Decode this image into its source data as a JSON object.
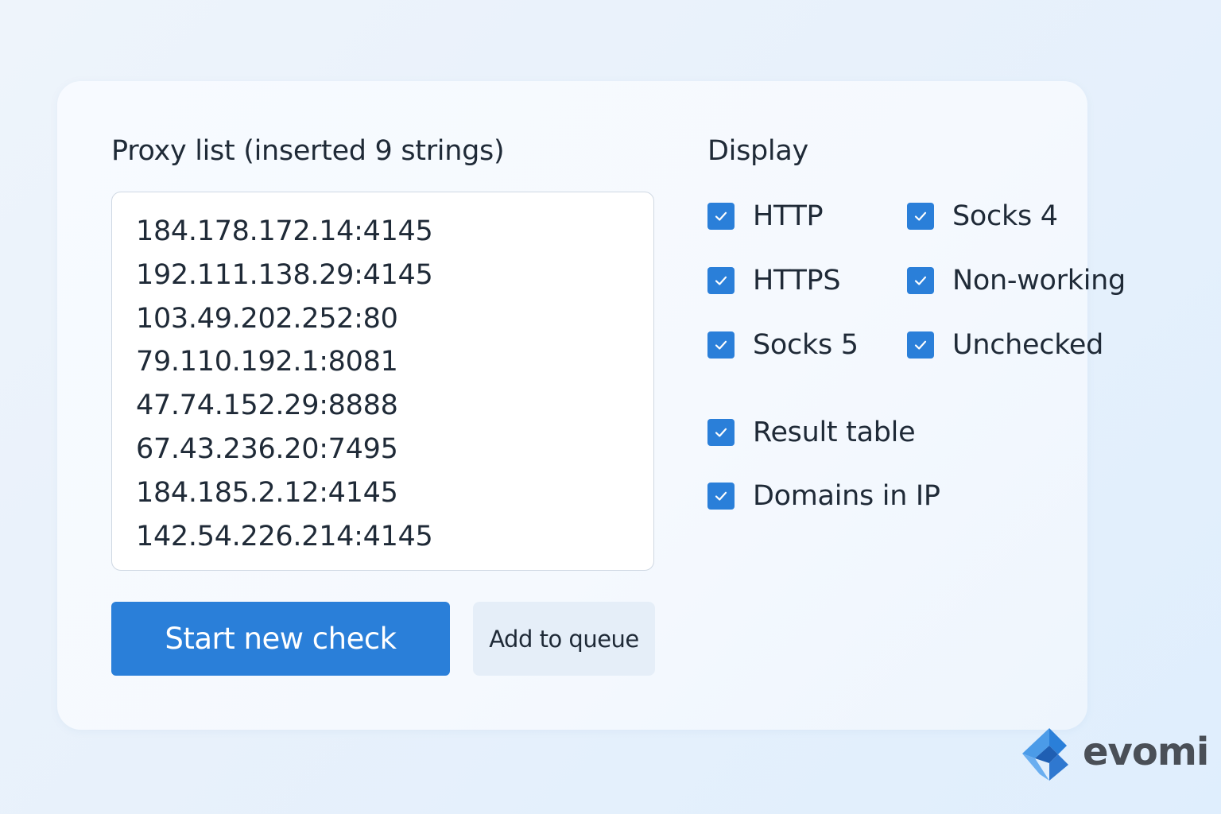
{
  "proxy_list": {
    "label": "Proxy list (inserted 9 strings)",
    "entries": [
      "184.178.172.14:4145",
      "192.111.138.29:4145",
      "103.49.202.252:80",
      "79.110.192.1:8081",
      "47.74.152.29:8888",
      "67.43.236.20:7495",
      "184.185.2.12:4145",
      "142.54.226.214:4145"
    ]
  },
  "actions": {
    "start_label": "Start new check",
    "queue_label": "Add to queue"
  },
  "display": {
    "label": "Display",
    "options": [
      {
        "label": "HTTP",
        "checked": true
      },
      {
        "label": "Socks 4",
        "checked": true
      },
      {
        "label": "HTTPS",
        "checked": true
      },
      {
        "label": "Non-working",
        "checked": true
      },
      {
        "label": "Socks 5",
        "checked": true
      },
      {
        "label": "Unchecked",
        "checked": true
      },
      {
        "label": "Result table",
        "checked": true
      },
      {
        "label": "Domains in IP",
        "checked": true
      }
    ]
  },
  "brand": {
    "name": "evomi",
    "icon": "evomi-logo-icon"
  },
  "colors": {
    "accent": "#2a7fd9",
    "secondary_button": "#e5eef8",
    "text": "#1f2a37"
  }
}
